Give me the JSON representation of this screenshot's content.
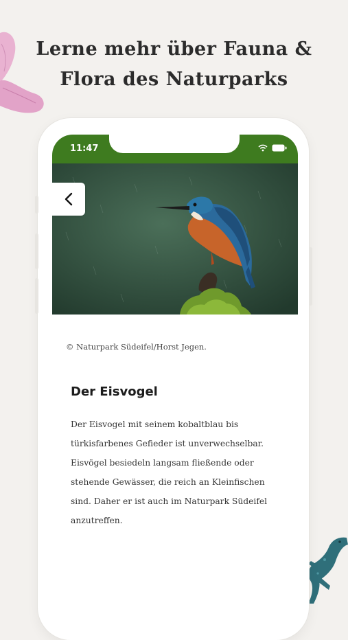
{
  "headline": {
    "line1": "Lerne mehr über Fauna &",
    "line2": "Flora des Naturparks"
  },
  "status_bar": {
    "time": "11:47",
    "icons": [
      "wifi-icon",
      "battery-icon"
    ]
  },
  "detail": {
    "back_icon": "chevron-left-icon",
    "image_subject": "kingfisher-photo",
    "credit": "© Naturpark Südeifel/Horst Jegen.",
    "title": "Der Eisvogel",
    "body_lines": [
      "Der Eisvogel mit seinem kobaltblau bis",
      "türkisfarbenes Gefieder ist unverwechselbar.",
      "Eisvögel besiedeln langsam fließende oder",
      "stehende Gewässer, die reich an Kleinfischen",
      "sind. Daher er ist auch im Naturpark Südeifel",
      "anzutreffen."
    ]
  },
  "colors": {
    "status_bar": "#3e7b1f",
    "background": "#f3f1ee",
    "flower": "#e2a3c8",
    "newt": "#2f6f7a"
  }
}
